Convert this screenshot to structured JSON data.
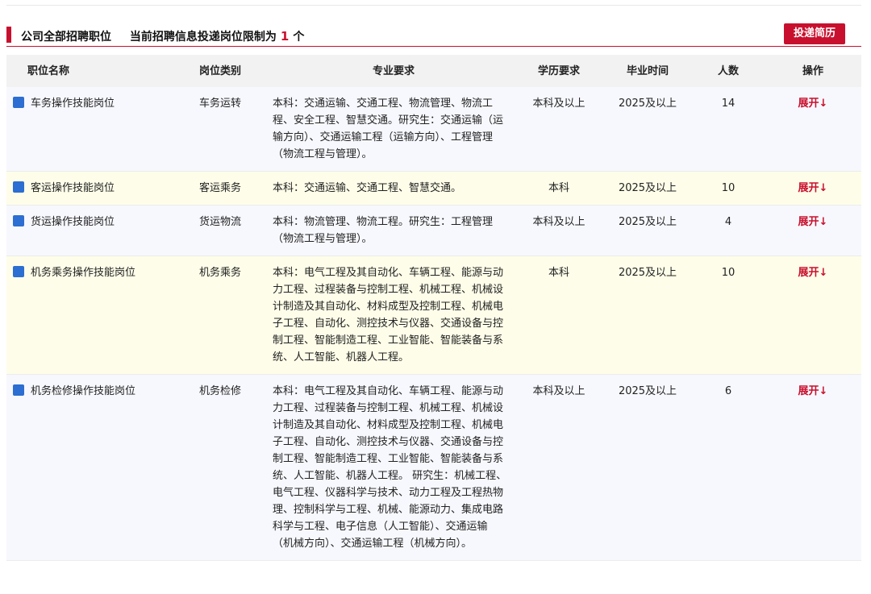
{
  "header": {
    "title": "公司全部招聘职位",
    "limit_prefix": "当前招聘信息投递岗位限制为",
    "limit_count": "1",
    "limit_suffix": "个",
    "apply_label": "投递简历"
  },
  "table": {
    "columns": [
      "职位名称",
      "岗位类别",
      "专业要求",
      "学历要求",
      "毕业时间",
      "人数",
      "操作"
    ],
    "rows": [
      {
        "name": "车务操作技能岗位",
        "category": "车务运转",
        "major": "本科：交通运输、交通工程、物流管理、物流工程、安全工程、智慧交通。研究生：交通运输（运输方向）、交通运输工程（运输方向）、工程管理（物流工程与管理）。",
        "degree": "本科及以上",
        "graduation": "2025及以上",
        "count": "14",
        "action": "展开↓"
      },
      {
        "name": "客运操作技能岗位",
        "category": "客运乘务",
        "major": "本科：交通运输、交通工程、智慧交通。",
        "degree": "本科",
        "graduation": "2025及以上",
        "count": "10",
        "action": "展开↓"
      },
      {
        "name": "货运操作技能岗位",
        "category": "货运物流",
        "major": "本科：物流管理、物流工程。研究生：工程管理（物流工程与管理）。",
        "degree": "本科及以上",
        "graduation": "2025及以上",
        "count": "4",
        "action": "展开↓"
      },
      {
        "name": "机务乘务操作技能岗位",
        "category": "机务乘务",
        "major": "本科：电气工程及其自动化、车辆工程、能源与动力工程、过程装备与控制工程、机械工程、机械设计制造及其自动化、材料成型及控制工程、机械电子工程、自动化、测控技术与仪器、交通设备与控制工程、智能制造工程、工业智能、智能装备与系统、人工智能、机器人工程。",
        "degree": "本科",
        "graduation": "2025及以上",
        "count": "10",
        "action": "展开↓"
      },
      {
        "name": "机务检修操作技能岗位",
        "category": "机务检修",
        "major": "本科：电气工程及其自动化、车辆工程、能源与动力工程、过程装备与控制工程、机械工程、机械设计制造及其自动化、材料成型及控制工程、机械电子工程、自动化、测控技术与仪器、交通设备与控制工程、智能制造工程、工业智能、智能装备与系统、人工智能、机器人工程。 研究生：机械工程、电气工程、仪器科学与技术、动力工程及工程热物理、控制科学与工程、机械、能源动力、集成电路科学与工程、电子信息（人工智能）、交通运输（机械方向）、交通运输工程（机械方向）。",
        "degree": "本科及以上",
        "graduation": "2025及以上",
        "count": "6",
        "action": "展开↓"
      }
    ]
  },
  "colors": {
    "accent": "#c8102e",
    "marker": "#2c6ed1",
    "row_blue": "#f7f8fd",
    "row_yellow": "#fefde9",
    "header_bg": "#f2f2f2"
  }
}
